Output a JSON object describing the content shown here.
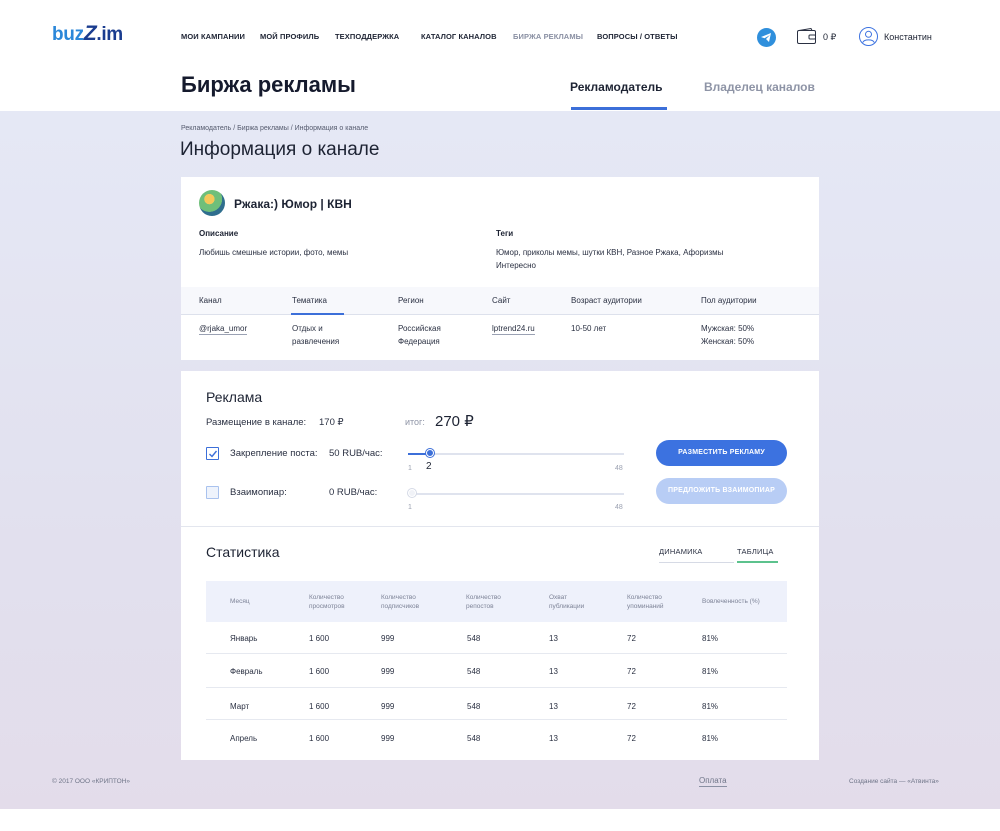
{
  "header": {
    "logo": {
      "part1": "buz",
      "part2": "Z",
      "part3": ".im"
    },
    "nav": [
      {
        "label": "МОИ КАМПАНИИ"
      },
      {
        "label": "МОЙ ПРОФИЛЬ"
      },
      {
        "label": "ТЕХПОДДЕРЖКА"
      },
      {
        "label": "КАТАЛОГ КАНАЛОВ"
      },
      {
        "label": "БИРЖА РЕКЛАМЫ"
      },
      {
        "label": "ВОПРОСЫ / ОТВЕТЫ"
      }
    ],
    "wallet_amount": "0 ₽",
    "user_name": "Константин"
  },
  "page": {
    "title": "Биржа рекламы",
    "role_tabs": [
      "Рекламодатель",
      "Владелец каналов"
    ],
    "breadcrumb": "Рекламодатель / Биржа рекламы / Информация о канале",
    "section_title": "Информация о канале"
  },
  "channel": {
    "name": "Ржака:) Юмор | КВН",
    "description_label": "Описание",
    "description": "Любишь смешные истории, фото, мемы",
    "tags_label": "Теги",
    "tags_line1": "Юмор, приколы мемы, шутки КВН, Разное Ржака, Афоризмы",
    "tags_line2": "Интересно",
    "info_headers": [
      "Канал",
      "Тематика",
      "Регион",
      "Сайт",
      "Возраст аудитории",
      "Пол аудитории"
    ],
    "info_values": {
      "channel": "@rjaka_umor",
      "topic_line1": "Отдых и",
      "topic_line2": "развлечения",
      "region_line1": "Российская",
      "region_line2": "Федерация",
      "site": "lptrend24.ru",
      "age": "10-50 лет",
      "gender_line1": "Мужская: 50%",
      "gender_line2": "Женская: 50%"
    }
  },
  "ad": {
    "title": "Реклама",
    "placement_label": "Размещение в канале:",
    "placement_value": "170 ₽",
    "total_label": "итог:",
    "total_value": "270 ₽",
    "pin": {
      "label": "Закрепление поста:",
      "price": "50 RUB/час:",
      "checked": true,
      "min": "1",
      "max": "48",
      "value": 2,
      "value_label": "2",
      "level": 0.0213
    },
    "mutual": {
      "label": "Взаимопиар:",
      "price": "0 RUB/час:",
      "checked": false,
      "min": "1",
      "max": "48",
      "value": 1,
      "level": 0
    },
    "buttons": {
      "place": "РАЗМЕСТИТЬ РЕКЛАМУ",
      "offer": "ПРЕДЛОЖИТЬ ВЗАИМОПИАР"
    }
  },
  "stats": {
    "title": "Статистика",
    "tabs": [
      "ДИНАМИКА",
      "ТАБЛИЦА"
    ],
    "active_tab": "ТАБЛИЦА",
    "columns": [
      {
        "line1": "Месяц",
        "line2": ""
      },
      {
        "line1": "Количество",
        "line2": "просмотров"
      },
      {
        "line1": "Количество",
        "line2": "подписчиков"
      },
      {
        "line1": "Количество",
        "line2": "репостов"
      },
      {
        "line1": "Охват",
        "line2": "публикации"
      },
      {
        "line1": "Количество",
        "line2": "упоминаний"
      },
      {
        "line1": "Вовлеченность (%)",
        "line2": ""
      }
    ],
    "rows": [
      [
        "Январь",
        "1 600",
        "999",
        "548",
        "13",
        "72",
        "81%"
      ],
      [
        "Февраль",
        "1 600",
        "999",
        "548",
        "13",
        "72",
        "81%"
      ],
      [
        "Март",
        "1 600",
        "999",
        "548",
        "13",
        "72",
        "81%"
      ],
      [
        "Апрель",
        "1 600",
        "999",
        "548",
        "13",
        "72",
        "81%"
      ]
    ]
  },
  "footer": {
    "copyright": "© 2017 ООО «КРИПТОН»",
    "payment": "Оплата",
    "credits": "Создание сайта — «Атвинта»"
  },
  "colors": {
    "accent": "#3c72e0",
    "telegram": "#2f8fdc",
    "active_tab_line": "#5cc28d"
  }
}
